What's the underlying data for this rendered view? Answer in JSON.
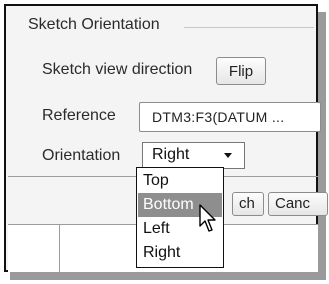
{
  "group": {
    "title": "Sketch Orientation"
  },
  "view_direction": {
    "label": "Sketch view direction",
    "flip_label": "Flip"
  },
  "reference": {
    "label": "Reference",
    "value": "DTM3:F3(DATUM ..."
  },
  "orientation": {
    "label": "Orientation",
    "selected": "Right",
    "options": [
      "Top",
      "Bottom",
      "Left",
      "Right"
    ],
    "highlighted": "Bottom"
  },
  "bottom_buttons": {
    "sketch_partial": "ch",
    "cancel_partial": "Canc"
  }
}
